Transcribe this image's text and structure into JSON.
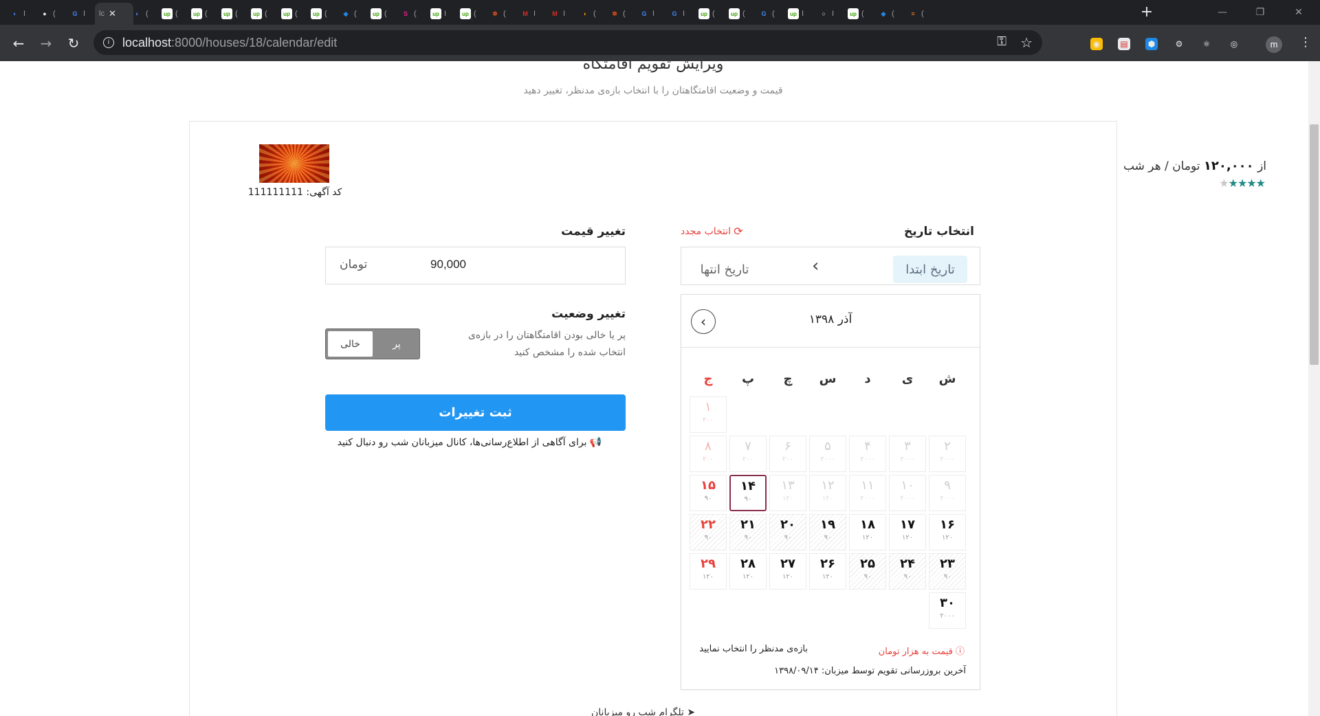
{
  "browser": {
    "tabs": [
      {
        "icon": "chrome-icon",
        "color": "#4285f4",
        "glyph": "◐",
        "char": "I"
      },
      {
        "icon": "github-icon",
        "color": "#e8eaed",
        "glyph": "●",
        "char": "("
      },
      {
        "icon": "google-icon",
        "color": "#4285f4",
        "glyph": "G",
        "char": "I"
      },
      {
        "icon": "localhost-icon",
        "color": "#9aa0a6",
        "glyph": "",
        "char": "lc",
        "active": true
      },
      {
        "icon": "chrome-icon",
        "color": "#4285f4",
        "glyph": "◐",
        "char": "("
      },
      {
        "icon": "upwork-icon",
        "color": "#37a000",
        "glyph": "up",
        "char": "("
      },
      {
        "icon": "upwork-icon",
        "color": "#37a000",
        "glyph": "up",
        "char": "("
      },
      {
        "icon": "upwork-icon",
        "color": "#37a000",
        "glyph": "up",
        "char": "("
      },
      {
        "icon": "upwork-icon",
        "color": "#37a000",
        "glyph": "up",
        "char": "("
      },
      {
        "icon": "upwork-icon",
        "color": "#37a000",
        "glyph": "up",
        "char": "("
      },
      {
        "icon": "upwork-icon",
        "color": "#37a000",
        "glyph": "up",
        "char": "("
      },
      {
        "icon": "extension-icon",
        "color": "#1e88e5",
        "glyph": "◆",
        "char": "("
      },
      {
        "icon": "upwork-icon",
        "color": "#37a000",
        "glyph": "up",
        "char": "("
      },
      {
        "icon": "figma-icon",
        "color": "#e91e8c",
        "glyph": "S",
        "char": "("
      },
      {
        "icon": "upwork-icon",
        "color": "#37a000",
        "glyph": "up",
        "char": "I"
      },
      {
        "icon": "upwork-icon",
        "color": "#37a000",
        "glyph": "up",
        "char": "("
      },
      {
        "icon": "ubuntu-icon",
        "color": "#e95420",
        "glyph": "✲",
        "char": "("
      },
      {
        "icon": "gmail-icon",
        "color": "#d93025",
        "glyph": "M",
        "char": "I"
      },
      {
        "icon": "gmail-icon",
        "color": "#d93025",
        "glyph": "M",
        "char": "I"
      },
      {
        "icon": "shell-icon",
        "color": "#f29900",
        "glyph": "◗",
        "char": "("
      },
      {
        "icon": "ubuntu-icon",
        "color": "#e95420",
        "glyph": "✲",
        "char": "("
      },
      {
        "icon": "google-icon",
        "color": "#4285f4",
        "glyph": "G",
        "char": "I"
      },
      {
        "icon": "google-icon",
        "color": "#4285f4",
        "glyph": "G",
        "char": "I"
      },
      {
        "icon": "upwork-icon",
        "color": "#37a000",
        "glyph": "up",
        "char": "("
      },
      {
        "icon": "upwork-icon",
        "color": "#37a000",
        "glyph": "up",
        "char": "("
      },
      {
        "icon": "google-icon",
        "color": "#4285f4",
        "glyph": "G",
        "char": "("
      },
      {
        "icon": "upwork-icon",
        "color": "#37a000",
        "glyph": "up",
        "char": "I"
      },
      {
        "icon": "circle-icon",
        "color": "#e8eaed",
        "glyph": "○",
        "char": "I"
      },
      {
        "icon": "upwork-icon",
        "color": "#37a000",
        "glyph": "up",
        "char": "("
      },
      {
        "icon": "extension-icon",
        "color": "#1e88e5",
        "glyph": "◆",
        "char": "("
      },
      {
        "icon": "stackoverflow-icon",
        "color": "#f48024",
        "glyph": "≡",
        "char": "("
      }
    ],
    "new_tab_glyph": "+",
    "window_controls": {
      "minimize": "—",
      "restore": "❐",
      "close": "✕"
    },
    "url_host": "localhost",
    "url_rest": ":8000/houses/18/calendar/edit",
    "profile_initial": "m"
  },
  "page": {
    "title": "ویرایش تقویم اقامتگاه",
    "subtitle": "قیمت و وضعیت اقامتگاهتان را با انتخاب بازه‌ی مدنظر، تغییر دهید"
  },
  "listing": {
    "price_prefix": "از",
    "price_value": "۱۲۰,۰۰۰",
    "price_suffix": "تومان / هر شب",
    "rating": 3.5,
    "ad_code_label": "کد آگهی:",
    "ad_code": "111111111"
  },
  "date_section": {
    "label": "انتخاب تاریخ",
    "reselect": "انتخاب مجدد",
    "start_label": "تاریخ ابتدا",
    "end_label": "تاریخ انتها"
  },
  "calendar": {
    "month": "آذر ۱۳۹۸",
    "weekdays": [
      "ش",
      "ی",
      "د",
      "س",
      "چ",
      "پ",
      "ج"
    ],
    "weeks": [
      [
        null,
        null,
        null,
        null,
        null,
        null,
        {
          "n": "۱",
          "p": "۲۰۰",
          "past": true
        }
      ],
      [
        {
          "n": "۲",
          "p": "۲۰۰۰",
          "past": true
        },
        {
          "n": "۳",
          "p": "۲۰۰۰",
          "past": true
        },
        {
          "n": "۴",
          "p": "۲۰۰۰",
          "past": true
        },
        {
          "n": "۵",
          "p": "۲۰۰۰",
          "past": true
        },
        {
          "n": "۶",
          "p": "۲۰۰",
          "past": true
        },
        {
          "n": "۷",
          "p": "۲۰۰",
          "past": true
        },
        {
          "n": "۸",
          "p": "۲۰۰",
          "past": true
        }
      ],
      [
        {
          "n": "۹",
          "p": "۲۰۰۰",
          "past": true
        },
        {
          "n": "۱۰",
          "p": "۲۰۰۰",
          "past": true
        },
        {
          "n": "۱۱",
          "p": "۲۰۰۰",
          "past": true
        },
        {
          "n": "۱۲",
          "p": "۱۲۰",
          "past": true
        },
        {
          "n": "۱۳",
          "p": "۱۲۰",
          "past": true
        },
        {
          "n": "۱۴",
          "p": "۹۰",
          "today": true
        },
        {
          "n": "۱۵",
          "p": "۹۰"
        }
      ],
      [
        {
          "n": "۱۶",
          "p": "۱۲۰"
        },
        {
          "n": "۱۷",
          "p": "۱۲۰"
        },
        {
          "n": "۱۸",
          "p": "۱۲۰"
        },
        {
          "n": "۱۹",
          "p": "۹۰",
          "booked": true
        },
        {
          "n": "۲۰",
          "p": "۹۰",
          "booked": true
        },
        {
          "n": "۲۱",
          "p": "۹۰",
          "booked": true
        },
        {
          "n": "۲۲",
          "p": "۹۰",
          "booked": true
        }
      ],
      [
        {
          "n": "۲۳",
          "p": "۹۰",
          "booked": true
        },
        {
          "n": "۲۴",
          "p": "۹۰",
          "booked": true
        },
        {
          "n": "۲۵",
          "p": "۹۰",
          "booked": true
        },
        {
          "n": "۲۶",
          "p": "۱۲۰"
        },
        {
          "n": "۲۷",
          "p": "۱۲۰"
        },
        {
          "n": "۲۸",
          "p": "۱۲۰"
        },
        {
          "n": "۲۹",
          "p": "۱۲۰"
        }
      ],
      [
        {
          "n": "۳۰",
          "p": "۲۰۰۰"
        },
        null,
        null,
        null,
        null,
        null,
        null
      ]
    ],
    "unit_note": "قیمت به هزار تومان",
    "hint": "بازه‌ی مدنظر را انتخاب نمایید",
    "last_update_label": "آخرین بروزرسانی تقویم توسط میزبان:",
    "last_update_date": "۱۳۹۸/۰۹/۱۴"
  },
  "price_section": {
    "label": "تغییر قیمت",
    "value": "90,000",
    "unit": "تومان"
  },
  "status_section": {
    "label": "تغییر وضعیت",
    "description": "پر یا خالی بودن اقامتگاهتان را در بازه‌ی انتخاب شده را مشخص کنید",
    "option_empty": "خالی",
    "option_full": "پر"
  },
  "submit": {
    "label": "ثبت تغییرات"
  },
  "channel_note": "برای آگاهی از اطلاع‌رسانی‌ها، کانال میزبانان شب رو دنبال کنید",
  "bottom_peek": "تلگرام شب رو میزبانان"
}
